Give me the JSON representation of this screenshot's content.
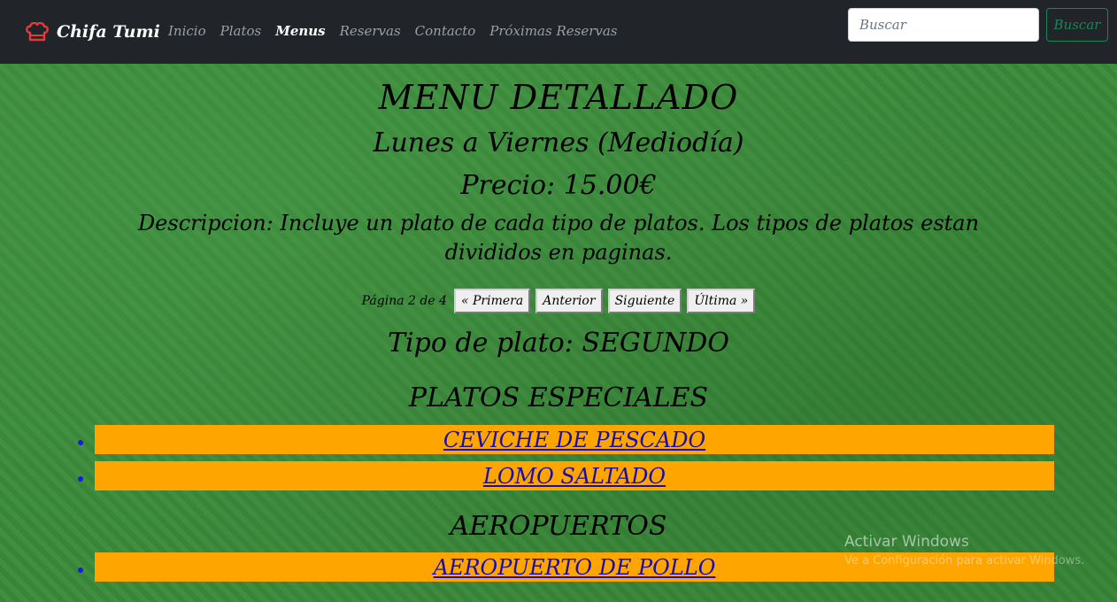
{
  "navbar": {
    "brand": "Chifa Tumi",
    "brand_icon": "chef-hat-icon",
    "links": [
      "Inicio",
      "Platos",
      "Menus",
      "Reservas",
      "Contacto",
      "Próximas Reservas"
    ],
    "active": "Menus",
    "search_placeholder": "Buscar",
    "search_button": "Buscar"
  },
  "menu": {
    "title": "MENU DETALLADO",
    "schedule": "Lunes a Viernes (Mediodía)",
    "price": "Precio: 15.00€",
    "description": "Descripcion: Incluye un plato de cada tipo de platos. Los tipos de platos estan divididos en paginas."
  },
  "pagination": {
    "info": "Página 2 de 4",
    "first": "« Primera",
    "prev": "Anterior",
    "next": "Siguiente",
    "last": "Última »"
  },
  "dish_type": "Tipo de plato: SEGUNDO",
  "sections": [
    {
      "title": "PLATOS ESPECIALES",
      "dishes": [
        "CEVICHE DE PESCADO",
        "LOMO SALTADO"
      ]
    },
    {
      "title": "AEROPUERTOS",
      "dishes": [
        "AEROPUERTO DE POLLO"
      ]
    }
  ],
  "watermark": {
    "title": "Activar Windows",
    "subtitle": "Ve a Configuración para activar Windows."
  },
  "colors": {
    "navbar": "#212529",
    "background": "#3a8a3a",
    "dish_highlight": "#ffa500",
    "link": "#1a0dab",
    "search_button": "#198754"
  }
}
